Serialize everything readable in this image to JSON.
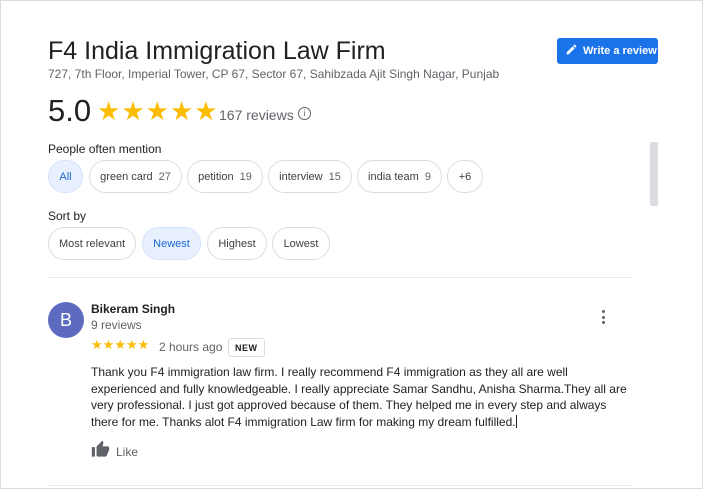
{
  "place": {
    "title": "F4 India Immigration Law Firm",
    "address": "727, 7th Floor, Imperial Tower, CP 67, Sector 67, Sahibzada Ajit Singh Nagar, Punjab",
    "rating": "5.0",
    "rating_value": 5,
    "review_count": "167 reviews",
    "info_icon_glyph": "i"
  },
  "header": {
    "write_review_label": "Write a review",
    "write_review_icon": "pencil-icon",
    "accent_color": "#1a73e8",
    "star_color": "#fbbc04"
  },
  "mentions": {
    "label": "People often mention",
    "chips": [
      {
        "label": "All",
        "count": "",
        "selected": true
      },
      {
        "label": "green card",
        "count": "27",
        "selected": false
      },
      {
        "label": "petition",
        "count": "19",
        "selected": false
      },
      {
        "label": "interview",
        "count": "15",
        "selected": false
      },
      {
        "label": "india team",
        "count": "9",
        "selected": false
      },
      {
        "label": "+6",
        "count": "",
        "selected": false
      }
    ]
  },
  "sort": {
    "label": "Sort by",
    "options": [
      {
        "label": "Most relevant",
        "selected": false
      },
      {
        "label": "Newest",
        "selected": true
      },
      {
        "label": "Highest",
        "selected": false
      },
      {
        "label": "Lowest",
        "selected": false
      }
    ]
  },
  "reviews": [
    {
      "avatar_letter": "B",
      "avatar_color": "#5c6bc0",
      "name": "Bikeram Singh",
      "meta": "9 reviews",
      "stars": 5,
      "time": "2 hours ago",
      "badge": "NEW",
      "text": "Thank you F4 immigration law firm. I really recommend F4 immigration as they all are well experienced and fully knowledgeable. I really appreciate Samar Sandhu, Anisha Sharma.They all are very professional. I just got approved because of them. They helped me in every step and always there for me. Thanks alot F4 immigration Law firm for making my dream fulfilled.",
      "like_label": "Like",
      "like_icon": "thumbs-up-icon",
      "more_icon": "more-vert-icon"
    }
  ]
}
